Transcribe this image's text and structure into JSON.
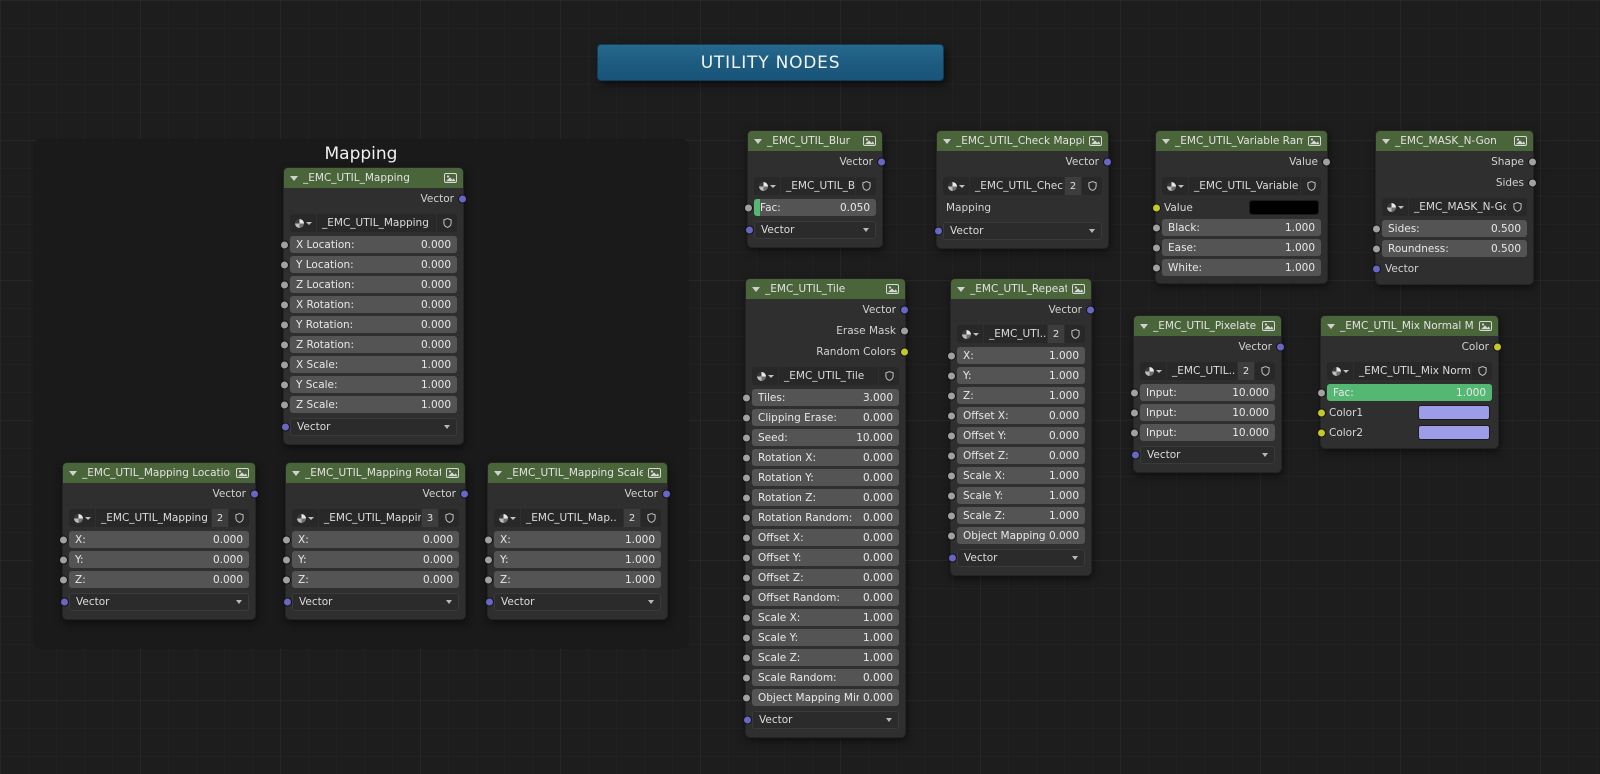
{
  "banner": {
    "label": "UTILITY NODES",
    "color": "#1c5a7e"
  },
  "frame": {
    "label": "Mapping"
  },
  "colors": {
    "node_header_green": "#4b653a",
    "socket_vector": "#6967c6",
    "socket_value": "#a1a1a1",
    "socket_color": "#c7c729",
    "slider_fill_green": "#54b873",
    "color_swatch_lavender": "#9d9ce8",
    "color_swatch_black": "#000000"
  },
  "nodes": [
    {
      "id": "mapping",
      "title": "_EMC_UTIL_Mapping",
      "outputs": [
        {
          "label": "Vector",
          "socket": "vector"
        }
      ],
      "selector": {
        "name": "_EMC_UTIL_Mapping",
        "count": ""
      },
      "items": [
        {
          "type": "field",
          "label": "X Location:",
          "value": "0.000",
          "socket": "value"
        },
        {
          "type": "field",
          "label": "Y Location:",
          "value": "0.000",
          "socket": "value"
        },
        {
          "type": "field",
          "label": "Z Location:",
          "value": "0.000",
          "socket": "value"
        },
        {
          "type": "field",
          "label": "X Rotation:",
          "value": "0.000",
          "socket": "value"
        },
        {
          "type": "field",
          "label": "Y Rotation:",
          "value": "0.000",
          "socket": "value"
        },
        {
          "type": "field",
          "label": "Z Rotation:",
          "value": "0.000",
          "socket": "value"
        },
        {
          "type": "field",
          "label": "X Scale:",
          "value": "1.000",
          "socket": "value"
        },
        {
          "type": "field",
          "label": "Y Scale:",
          "value": "1.000",
          "socket": "value"
        },
        {
          "type": "field",
          "label": "Z Scale:",
          "value": "1.000",
          "socket": "value"
        },
        {
          "type": "dropdown",
          "label": "Vector",
          "socket": "vector"
        }
      ]
    },
    {
      "id": "maploc",
      "title": "_EMC_UTIL_Mapping Location",
      "outputs": [
        {
          "label": "Vector",
          "socket": "vector"
        }
      ],
      "selector": {
        "name": "_EMC_UTIL_Mapping ..",
        "count": "2"
      },
      "items": [
        {
          "type": "field",
          "label": "X:",
          "value": "0.000",
          "socket": "value"
        },
        {
          "type": "field",
          "label": "Y:",
          "value": "0.000",
          "socket": "value"
        },
        {
          "type": "field",
          "label": "Z:",
          "value": "0.000",
          "socket": "value"
        },
        {
          "type": "dropdown",
          "label": "Vector",
          "socket": "vector"
        }
      ]
    },
    {
      "id": "maprot",
      "title": "_EMC_UTIL_Mapping Rotation",
      "outputs": [
        {
          "label": "Vector",
          "socket": "vector"
        }
      ],
      "selector": {
        "name": "_EMC_UTIL_Mappin..",
        "count": "3"
      },
      "items": [
        {
          "type": "field",
          "label": "X:",
          "value": "0.000",
          "socket": "value"
        },
        {
          "type": "field",
          "label": "Y:",
          "value": "0.000",
          "socket": "value"
        },
        {
          "type": "field",
          "label": "Z:",
          "value": "0.000",
          "socket": "value"
        },
        {
          "type": "dropdown",
          "label": "Vector",
          "socket": "vector"
        }
      ]
    },
    {
      "id": "mapscale",
      "title": "_EMC_UTIL_Mapping Scale",
      "outputs": [
        {
          "label": "Vector",
          "socket": "vector"
        }
      ],
      "selector": {
        "name": "_EMC_UTIL_Map..",
        "count": "2"
      },
      "items": [
        {
          "type": "field",
          "label": "X:",
          "value": "1.000",
          "socket": "value"
        },
        {
          "type": "field",
          "label": "Y:",
          "value": "1.000",
          "socket": "value"
        },
        {
          "type": "field",
          "label": "Z:",
          "value": "1.000",
          "socket": "value"
        },
        {
          "type": "dropdown",
          "label": "Vector",
          "socket": "vector"
        }
      ]
    },
    {
      "id": "blur",
      "title": "_EMC_UTIL_Blur",
      "outputs": [
        {
          "label": "Vector",
          "socket": "vector"
        }
      ],
      "selector": {
        "name": "_EMC_UTIL_Blur",
        "count": ""
      },
      "items": [
        {
          "type": "field",
          "label": "Fac:",
          "value": "0.050",
          "socket": "value",
          "fill": 0.05
        },
        {
          "type": "dropdown",
          "label": "Vector",
          "socket": "vector"
        }
      ]
    },
    {
      "id": "check",
      "title": "_EMC_UTIL_Check Mapping",
      "outputs": [
        {
          "label": "Vector",
          "socket": "vector"
        }
      ],
      "selector": {
        "name": "_EMC_UTIL_Check ..",
        "count": "2"
      },
      "items": [
        {
          "type": "label",
          "label": "Mapping"
        },
        {
          "type": "dropdown",
          "label": "Vector",
          "socket": "vector"
        }
      ]
    },
    {
      "id": "ramp",
      "title": "_EMC_UTIL_Variable Ramp",
      "outputs": [
        {
          "label": "Value",
          "socket": "value"
        }
      ],
      "selector": {
        "name": "_EMC_UTIL_Variable Ra..",
        "count": ""
      },
      "items": [
        {
          "type": "color",
          "label": "Value",
          "swatch": "#000000",
          "socket": "color"
        },
        {
          "type": "field",
          "label": "Black:",
          "value": "1.000",
          "socket": "value"
        },
        {
          "type": "field",
          "label": "Ease:",
          "value": "1.000",
          "socket": "value"
        },
        {
          "type": "field",
          "label": "White:",
          "value": "1.000",
          "socket": "value"
        }
      ]
    },
    {
      "id": "ngon",
      "title": "_EMC_MASK_N-Gon",
      "outputs": [
        {
          "label": "Shape",
          "socket": "value"
        },
        {
          "label": "Sides",
          "socket": "value"
        }
      ],
      "selector": {
        "name": "_EMC_MASK_N-Gon",
        "count": ""
      },
      "items": [
        {
          "type": "field",
          "label": "Sides:",
          "value": "0.500",
          "socket": "value"
        },
        {
          "type": "field",
          "label": "Roundness:",
          "value": "0.500",
          "socket": "value"
        },
        {
          "type": "label",
          "label": "Vector",
          "socket": "vector"
        }
      ]
    },
    {
      "id": "tile",
      "title": "_EMC_UTIL_Tile",
      "outputs": [
        {
          "label": "Vector",
          "socket": "vector"
        },
        {
          "label": "Erase Mask",
          "socket": "value"
        },
        {
          "label": "Random Colors",
          "socket": "color"
        }
      ],
      "selector": {
        "name": "_EMC_UTIL_Tile",
        "count": ""
      },
      "items": [
        {
          "type": "field",
          "label": "Tiles:",
          "value": "3.000",
          "socket": "value"
        },
        {
          "type": "field",
          "label": "Clipping Erase:",
          "value": "0.000",
          "socket": "value"
        },
        {
          "type": "field",
          "label": "Seed:",
          "value": "10.000",
          "socket": "value"
        },
        {
          "type": "field",
          "label": "Rotation X:",
          "value": "0.000",
          "socket": "value"
        },
        {
          "type": "field",
          "label": "Rotation Y:",
          "value": "0.000",
          "socket": "value"
        },
        {
          "type": "field",
          "label": "Rotation Z:",
          "value": "0.000",
          "socket": "value"
        },
        {
          "type": "field",
          "label": "Rotation Random:",
          "value": "0.000",
          "socket": "value"
        },
        {
          "type": "field",
          "label": "Offset X:",
          "value": "0.000",
          "socket": "value"
        },
        {
          "type": "field",
          "label": "Offset Y:",
          "value": "0.000",
          "socket": "value"
        },
        {
          "type": "field",
          "label": "Offset Z:",
          "value": "0.000",
          "socket": "value"
        },
        {
          "type": "field",
          "label": "Offset Random:",
          "value": "0.000",
          "socket": "value"
        },
        {
          "type": "field",
          "label": "Scale X:",
          "value": "1.000",
          "socket": "value"
        },
        {
          "type": "field",
          "label": "Scale Y:",
          "value": "1.000",
          "socket": "value"
        },
        {
          "type": "field",
          "label": "Scale Z:",
          "value": "1.000",
          "socket": "value"
        },
        {
          "type": "field",
          "label": "Scale Random:",
          "value": "0.000",
          "socket": "value"
        },
        {
          "type": "field",
          "label": "Object Mapping Mirror:",
          "value": "0.000",
          "socket": "value"
        },
        {
          "type": "dropdown",
          "label": "Vector",
          "socket": "vector"
        }
      ]
    },
    {
      "id": "repeat",
      "title": "_EMC_UTIL_Repeat",
      "outputs": [
        {
          "label": "Vector",
          "socket": "vector"
        }
      ],
      "selector": {
        "name": "_EMC_UTI..",
        "count": "2"
      },
      "items": [
        {
          "type": "field",
          "label": "X:",
          "value": "1.000",
          "socket": "value"
        },
        {
          "type": "field",
          "label": "Y:",
          "value": "1.000",
          "socket": "value"
        },
        {
          "type": "field",
          "label": "Z:",
          "value": "1.000",
          "socket": "value"
        },
        {
          "type": "field",
          "label": "Offset X:",
          "value": "0.000",
          "socket": "value"
        },
        {
          "type": "field",
          "label": "Offset Y:",
          "value": "0.000",
          "socket": "value"
        },
        {
          "type": "field",
          "label": "Offset Z:",
          "value": "0.000",
          "socket": "value"
        },
        {
          "type": "field",
          "label": "Scale X:",
          "value": "1.000",
          "socket": "value"
        },
        {
          "type": "field",
          "label": "Scale Y:",
          "value": "1.000",
          "socket": "value"
        },
        {
          "type": "field",
          "label": "Scale Z:",
          "value": "1.000",
          "socket": "value"
        },
        {
          "type": "field",
          "label": "Object Mapping Mi:",
          "value": "0.000",
          "socket": "value"
        },
        {
          "type": "dropdown",
          "label": "Vector",
          "socket": "vector"
        }
      ]
    },
    {
      "id": "pixelate",
      "title": "_EMC_UTIL_Pixelate",
      "outputs": [
        {
          "label": "Vector",
          "socket": "vector"
        }
      ],
      "selector": {
        "name": "_EMC_UTIL..",
        "count": "2"
      },
      "items": [
        {
          "type": "field",
          "label": "Input:",
          "value": "10.000",
          "socket": "value"
        },
        {
          "type": "field",
          "label": "Input:",
          "value": "10.000",
          "socket": "value"
        },
        {
          "type": "field",
          "label": "Input:",
          "value": "10.000",
          "socket": "value"
        },
        {
          "type": "dropdown",
          "label": "Vector",
          "socket": "vector"
        }
      ]
    },
    {
      "id": "mix",
      "title": "_EMC_UTIL_Mix Normal Map",
      "outputs": [
        {
          "label": "Color",
          "socket": "color"
        }
      ],
      "selector": {
        "name": "_EMC_UTIL_Mix Normal ..",
        "count": ""
      },
      "items": [
        {
          "type": "field",
          "label": "Fac:",
          "value": "1.000",
          "socket": "value",
          "fill": 1
        },
        {
          "type": "color",
          "label": "Color1",
          "swatch": "#9d9ce8",
          "socket": "color"
        },
        {
          "type": "color",
          "label": "Color2",
          "swatch": "#9d9ce8",
          "socket": "color"
        }
      ]
    }
  ]
}
